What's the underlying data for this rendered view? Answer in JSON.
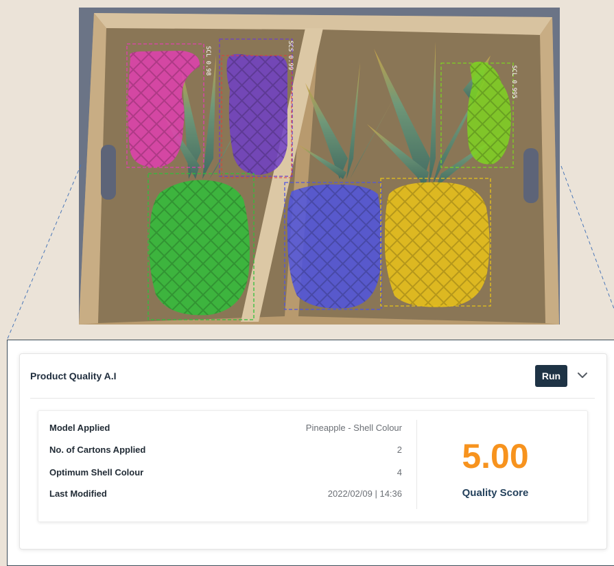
{
  "photo": {
    "detections": [
      {
        "label": "SCL 0.98",
        "color": "#e040b0"
      },
      {
        "label": "SCS 0.99",
        "color": "#6e3fc7"
      },
      {
        "label": "SCL 0.995",
        "color": "#7ed321"
      },
      {
        "label": "",
        "color": "#2fbf3a"
      },
      {
        "label": "",
        "color": "#4f55e0"
      },
      {
        "label": "",
        "color": "#e8c21a"
      }
    ]
  },
  "panel": {
    "title": "Product Quality A.I",
    "run_label": "Run",
    "rows": [
      {
        "label": "Model Applied",
        "value": "Pineapple - Shell Colour"
      },
      {
        "label": "No. of Cartons Applied",
        "value": "2"
      },
      {
        "label": "Optimum Shell Colour",
        "value": "4"
      },
      {
        "label": "Last Modified",
        "value": "2022/02/09 | 14:36"
      }
    ],
    "score": "5.00",
    "score_label": "Quality Score"
  },
  "colors": {
    "accent_orange": "#f7931e",
    "run_button": "#1e3345",
    "score_label": "#24415c"
  },
  "icons": {
    "collapse": "chevron-down-icon"
  }
}
